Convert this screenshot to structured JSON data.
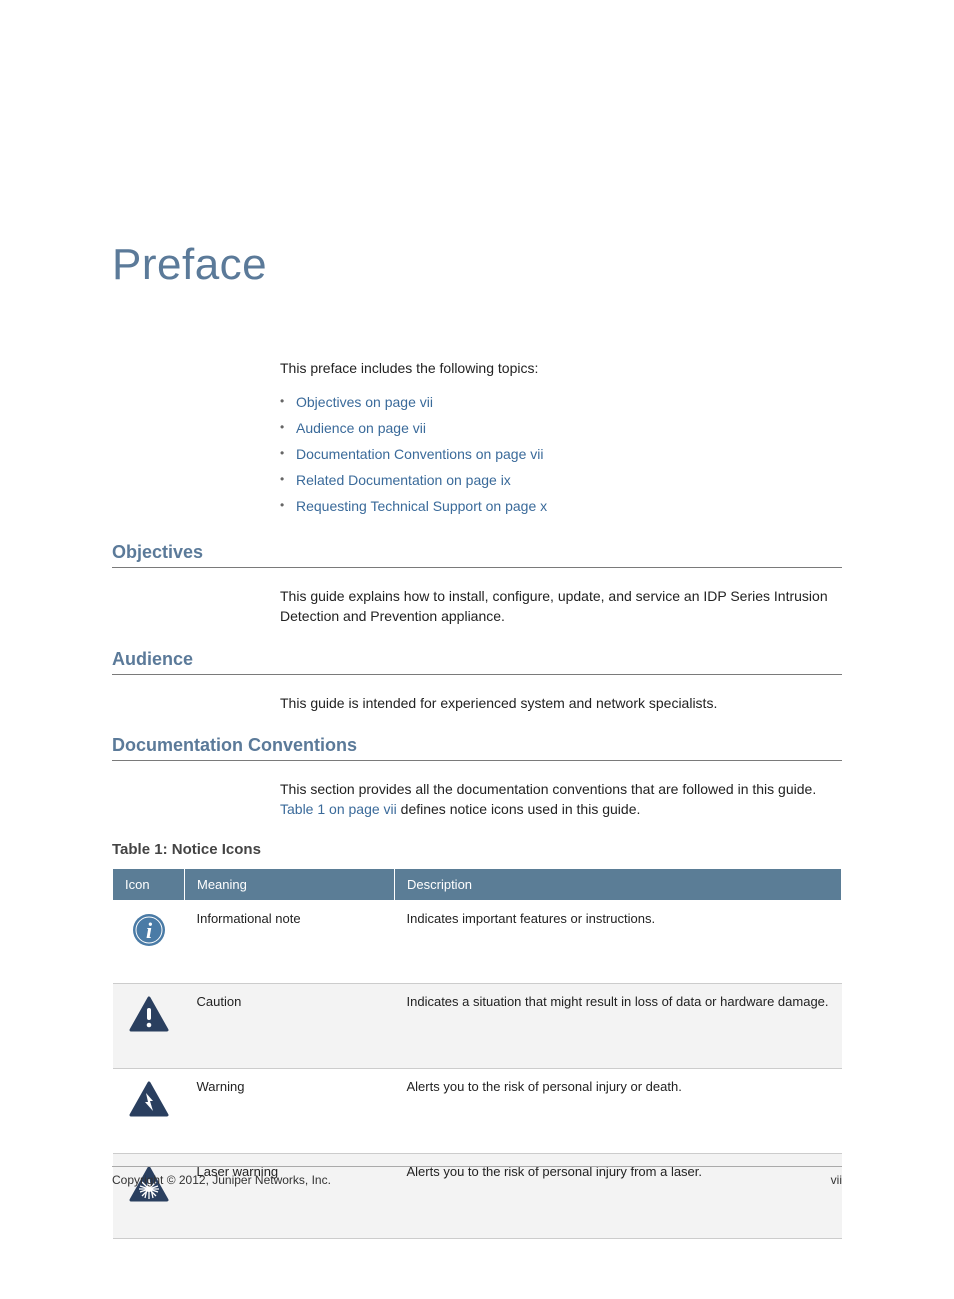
{
  "page_title": "Preface",
  "intro_text": "This preface includes the following topics:",
  "topics": [
    "Objectives on page vii",
    "Audience on page vii",
    "Documentation Conventions on page vii",
    "Related Documentation on page ix",
    "Requesting Technical Support on page x"
  ],
  "sections": {
    "objectives": {
      "heading": "Objectives",
      "body": "This guide explains how to install, configure, update, and service an IDP Series Intrusion Detection and Prevention appliance."
    },
    "audience": {
      "heading": "Audience",
      "body": "This guide is intended for experienced system and network specialists."
    },
    "conventions": {
      "heading": "Documentation Conventions",
      "body_prefix": "This section provides all the documentation conventions that are followed in this guide. ",
      "body_link": "Table 1 on page vii",
      "body_suffix": " defines notice icons used in this guide."
    }
  },
  "table1": {
    "caption": "Table 1: Notice Icons",
    "headers": {
      "icon": "Icon",
      "meaning": "Meaning",
      "description": "Description"
    },
    "rows": [
      {
        "icon_name": "info-icon",
        "meaning": "Informational note",
        "description": "Indicates important features or instructions."
      },
      {
        "icon_name": "caution-icon",
        "meaning": "Caution",
        "description": "Indicates a situation that might result in loss of data or hardware damage."
      },
      {
        "icon_name": "warning-icon",
        "meaning": "Warning",
        "description": "Alerts you to the risk of personal injury or death."
      },
      {
        "icon_name": "laser-warning-icon",
        "meaning": "Laser warning",
        "description": "Alerts you to the risk of personal injury from a laser."
      }
    ]
  },
  "footer": {
    "copyright": "Copyright © 2012, Juniper Networks, Inc.",
    "page_number": "vii"
  }
}
